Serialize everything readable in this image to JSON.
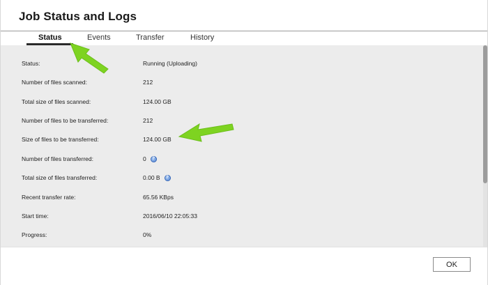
{
  "dialog": {
    "title": "Job Status and Logs"
  },
  "tabs": [
    {
      "label": "Status",
      "active": true
    },
    {
      "label": "Events",
      "active": false
    },
    {
      "label": "Transfer",
      "active": false
    },
    {
      "label": "History",
      "active": false
    }
  ],
  "status_rows": [
    {
      "label": "Status:",
      "value": "Running (Uploading)",
      "help": false
    },
    {
      "label": "Number of files scanned:",
      "value": "212",
      "help": false
    },
    {
      "label": "Total size of files scanned:",
      "value": "124.00 GB",
      "help": false
    },
    {
      "label": "Number of files to be transferred:",
      "value": "212",
      "help": false
    },
    {
      "label": "Size of files to be transferred:",
      "value": "124.00 GB",
      "help": false
    },
    {
      "label": "Number of files transferred:",
      "value": "0",
      "help": true
    },
    {
      "label": "Total size of files transferred:",
      "value": "0.00 B",
      "help": true
    },
    {
      "label": "Recent transfer rate:",
      "value": "65.56 KBps",
      "help": false
    },
    {
      "label": "Start time:",
      "value": "2016/06/10 22:05:33",
      "help": false
    },
    {
      "label": "Progress:",
      "value": "0%",
      "help": false
    }
  ],
  "footer": {
    "ok_label": "OK"
  },
  "colors": {
    "annotation_arrow": "#7ed321",
    "content_background": "#ececec",
    "help_icon": "#4a7fd1"
  }
}
